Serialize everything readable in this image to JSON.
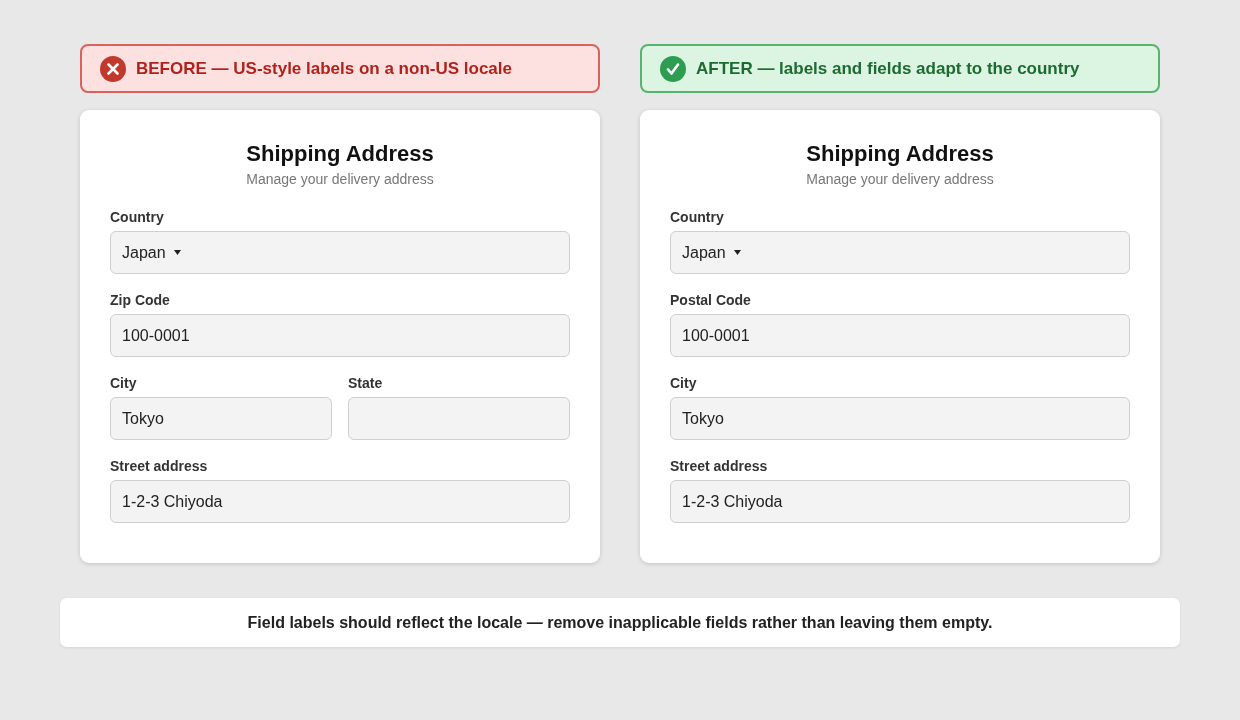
{
  "panels": [
    {
      "kind": "bad",
      "banner": "BEFORE — US-style labels on a non-US locale",
      "form": {
        "title": "Shipping Address",
        "subtitle": "Manage your delivery address",
        "rows": [
          {
            "fields": [
              {
                "kind": "select",
                "label": "Country",
                "value": "Japan"
              }
            ]
          },
          {
            "fields": [
              {
                "kind": "text",
                "label": "Zip Code",
                "value": "100-0001"
              }
            ]
          },
          {
            "fields": [
              {
                "kind": "text",
                "label": "City",
                "value": "Tokyo"
              },
              {
                "kind": "text",
                "label": "State"
              }
            ]
          },
          {
            "fields": [
              {
                "kind": "text",
                "label": "Street address",
                "value": "1-2-3 Chiyoda"
              }
            ]
          }
        ]
      }
    },
    {
      "kind": "good",
      "banner": "AFTER — labels and fields adapt to the country",
      "form": {
        "title": "Shipping Address",
        "subtitle": "Manage your delivery address",
        "rows": [
          {
            "fields": [
              {
                "kind": "select",
                "label": "Country",
                "value": "Japan"
              }
            ]
          },
          {
            "fields": [
              {
                "kind": "text",
                "label": "Postal Code",
                "value": "100-0001"
              }
            ]
          },
          {
            "fields": [
              {
                "kind": "text",
                "label": "City",
                "value": "Tokyo"
              }
            ]
          },
          {
            "fields": [
              {
                "kind": "text",
                "label": "Street address",
                "value": "1-2-3 Chiyoda"
              }
            ]
          }
        ]
      }
    }
  ],
  "note": "Field labels should reflect the locale — remove inapplicable fields rather than leaving them empty."
}
